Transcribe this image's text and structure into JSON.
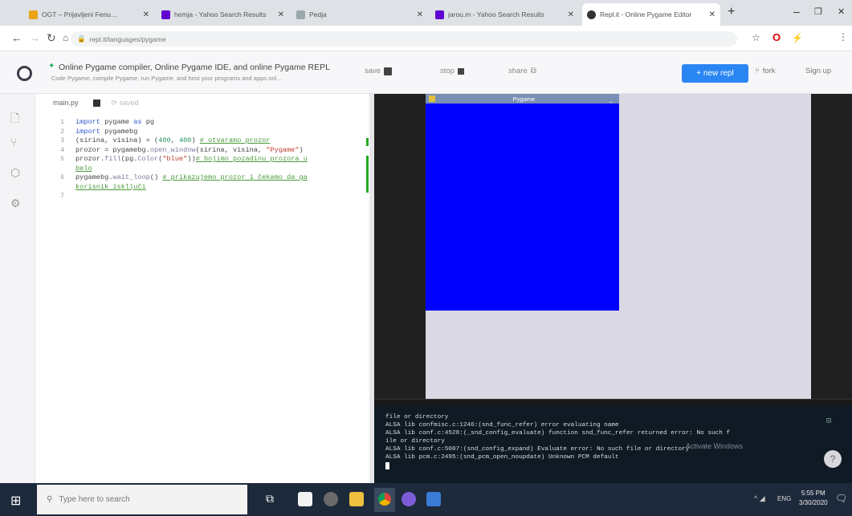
{
  "browser": {
    "tabs": [
      {
        "label": "OGT – Prijavljeni Fenu…",
        "color": "#e8a317"
      },
      {
        "label": "hemja - Yahoo Search Results",
        "color": "#5f01d1"
      },
      {
        "label": "Pedja",
        "color": "#7b7b7b"
      },
      {
        "label": "jarou.m - Yahoo Search Results",
        "color": "#5f01d1"
      },
      {
        "label": "Repl.it - Online Pygame Editor",
        "color": "#333"
      }
    ],
    "new_tab": "+",
    "url": "repl.it/languages/pygame",
    "controls": {
      "min": "–",
      "max": "❐",
      "close": "✕"
    }
  },
  "header": {
    "title": "Online Pygame compiler, Online Pygame IDE, and online Pygame REPL",
    "subtitle": "Code Pygame, compile Pygame, run Pygame, and host your programs and apps onl…",
    "save": "save",
    "stop": "stop",
    "share": "share",
    "new_repl": "+ new repl",
    "fork": "fork",
    "signup": "Sign up",
    "colors": {
      "accent": "#2a86f3"
    }
  },
  "editor": {
    "file": "main.py",
    "saved": "saved",
    "lines": [
      {
        "n": "1",
        "parts": [
          [
            "kw",
            "import "
          ],
          [
            "",
            "pygame "
          ],
          [
            "kw",
            "as "
          ],
          [
            "",
            "pg"
          ]
        ]
      },
      {
        "n": "2",
        "parts": [
          [
            "kw",
            "import "
          ],
          [
            "",
            "pygamebg"
          ]
        ]
      },
      {
        "n": "3",
        "parts": [
          [
            "",
            "(sirina, visina) = ("
          ],
          [
            "num",
            "400"
          ],
          [
            "",
            ", "
          ],
          [
            "num",
            "400"
          ],
          [
            "",
            ") "
          ],
          [
            "cm",
            "# otvaramo prozor"
          ]
        ]
      },
      {
        "n": "4",
        "parts": [
          [
            "",
            "prozor = pygamebg."
          ],
          [
            "fn",
            "open_window"
          ],
          [
            "",
            "(sirina, visina, "
          ],
          [
            "str",
            "\"Pygame\""
          ],
          [
            "",
            ")"
          ]
        ]
      },
      {
        "n": "5",
        "parts": [
          [
            "",
            "prozor."
          ],
          [
            "fn",
            "fill"
          ],
          [
            "",
            "(pg."
          ],
          [
            "fn",
            "Color"
          ],
          [
            "",
            "("
          ],
          [
            "str",
            "\"blue\""
          ],
          [
            "",
            "))"
          ],
          [
            "cm",
            "# bojimo pozadinu prozora u"
          ]
        ]
      },
      {
        "n": "",
        "parts": [
          [
            "cm",
            "belo"
          ]
        ]
      },
      {
        "n": "6",
        "parts": [
          [
            "",
            "pygamebg."
          ],
          [
            "fn",
            "wait_loop"
          ],
          [
            "",
            "() "
          ],
          [
            "cm",
            "# prikazujemo prozor i čekamo da ga"
          ]
        ]
      },
      {
        "n": "",
        "parts": [
          [
            "cm",
            "korisnik isključi"
          ]
        ]
      },
      {
        "n": "7",
        "parts": [
          [
            "",
            ""
          ]
        ]
      }
    ]
  },
  "output": {
    "window_title": "Pygame",
    "surface_color": "#0000ff"
  },
  "console": {
    "lines": [
      "file or directory",
      "ALSA lib confmisc.c:1246:(snd_func_refer) error evaluating name",
      "ALSA lib conf.c:4528:(_snd_config_evaluate) function snd_func_refer returned error: No such f",
      "ile or directory",
      "ALSA lib conf.c:5007:(snd_config_expand) Evaluate error: No such file or directory",
      "ALSA lib pcm.c:2495:(snd_pcm_open_noupdate) Unknown PCM default"
    ],
    "watermark": "Activate Windows"
  },
  "taskbar": {
    "search_placeholder": "Type here to search",
    "lang": "ENG",
    "time": "5:55 PM",
    "date": "3/30/2020"
  }
}
